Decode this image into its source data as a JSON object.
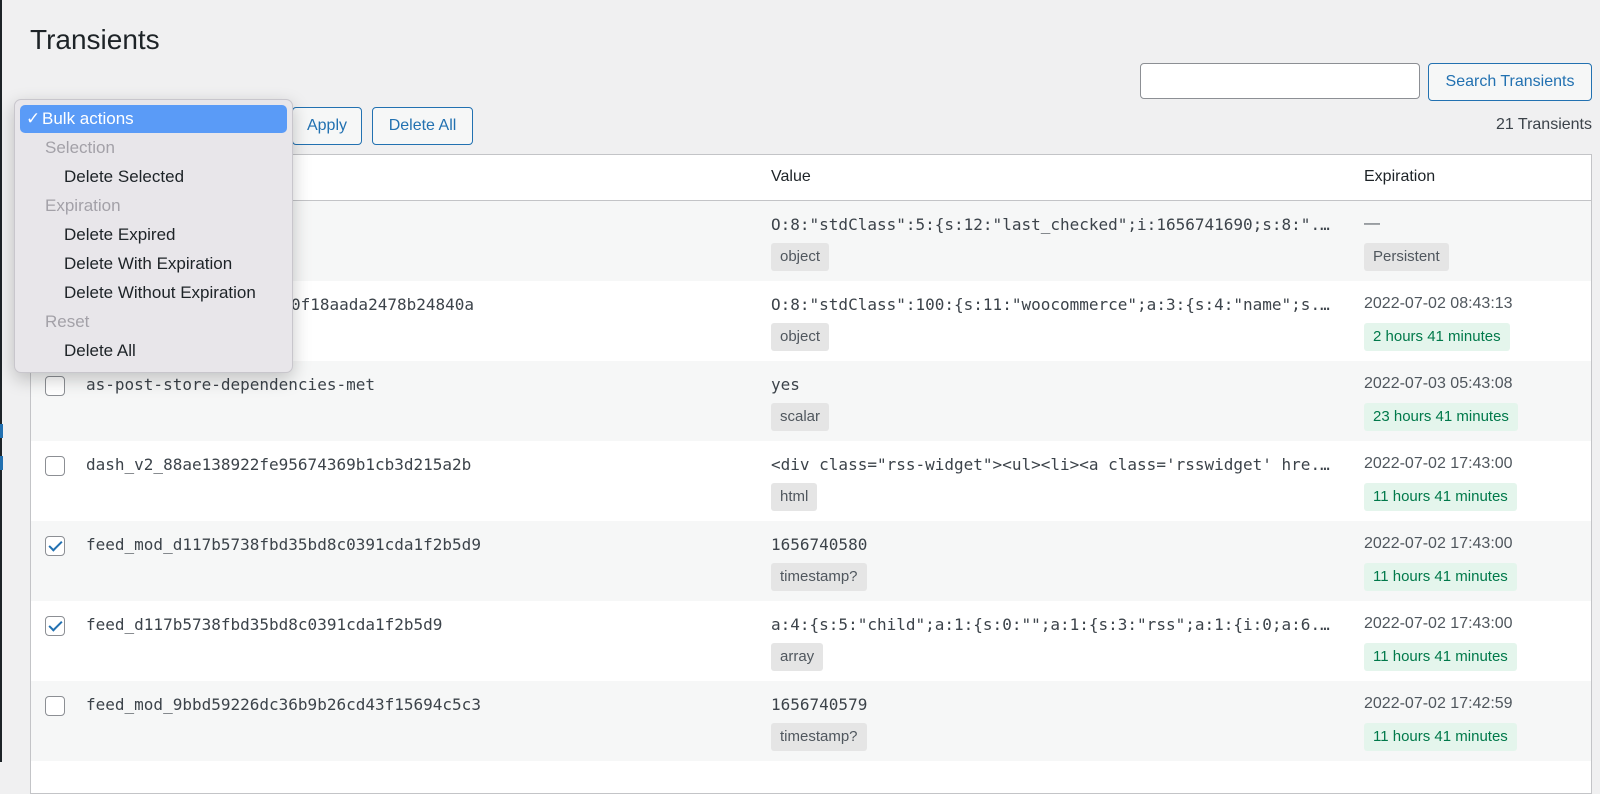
{
  "page": {
    "title": "Transients"
  },
  "search": {
    "button_label": "Search Transients",
    "value": ""
  },
  "toolbar": {
    "apply_label": "Apply",
    "delete_all_label": "Delete All",
    "count_label": "21 Transients"
  },
  "table": {
    "headers": {
      "value": "Value",
      "expiration": "Expiration"
    },
    "rows": [
      {
        "name": "",
        "value": "O:8:\"stdClass\":5:{s:12:\"last_checked\";i:1656741690;s:8:\"...",
        "value_type": "object",
        "expiration_date": "—",
        "expiration_label": "Persistent",
        "checked": false
      },
      {
        "name": "0f18aada2478b24840a",
        "value": "O:8:\"stdClass\":100:{s:11:\"woocommerce\";a:3:{s:4:\"name\";s...",
        "value_type": "object",
        "expiration_date": "2022-07-02 08:43:13",
        "expiration_label": "2 hours 41 minutes",
        "checked": false
      },
      {
        "name": "as-post-store-dependencies-met",
        "value": "yes",
        "value_type": "scalar",
        "expiration_date": "2022-07-03 05:43:08",
        "expiration_label": "23 hours 41 minutes",
        "checked": false
      },
      {
        "name": "dash_v2_88ae138922fe95674369b1cb3d215a2b",
        "value": "<div class=\"rss-widget\"><ul><li><a class='rsswidget' hre...",
        "value_type": "html",
        "expiration_date": "2022-07-02 17:43:00",
        "expiration_label": "11 hours 41 minutes",
        "checked": false
      },
      {
        "name": "feed_mod_d117b5738fbd35bd8c0391cda1f2b5d9",
        "value": "1656740580",
        "value_type": "timestamp?",
        "expiration_date": "2022-07-02 17:43:00",
        "expiration_label": "11 hours 41 minutes",
        "checked": true
      },
      {
        "name": "feed_d117b5738fbd35bd8c0391cda1f2b5d9",
        "value": "a:4:{s:5:\"child\";a:1:{s:0:\"\";a:1:{s:3:\"rss\";a:1:{i:0;a:6...",
        "value_type": "array",
        "expiration_date": "2022-07-02 17:43:00",
        "expiration_label": "11 hours 41 minutes",
        "checked": true
      },
      {
        "name": "feed_mod_9bbd59226dc36b9b26cd43f15694c5c3",
        "value": "1656740579",
        "value_type": "timestamp?",
        "expiration_date": "2022-07-02 17:42:59",
        "expiration_label": "11 hours 41 minutes",
        "checked": false
      }
    ]
  },
  "bulk_actions": {
    "selected": "Bulk actions",
    "groups": [
      {
        "label": "Selection",
        "options": [
          "Delete Selected"
        ]
      },
      {
        "label": "Expiration",
        "options": [
          "Delete Expired",
          "Delete With Expiration",
          "Delete Without Expiration"
        ]
      },
      {
        "label": "Reset",
        "options": [
          "Delete All"
        ]
      }
    ]
  },
  "colors": {
    "accent": "#2271b1",
    "dropdown_highlight": "#5a9bf7",
    "badge_green_bg": "#e4f5ec",
    "badge_green_text": "#00794a"
  },
  "icons": {
    "selected_check": "checkmark-icon"
  }
}
